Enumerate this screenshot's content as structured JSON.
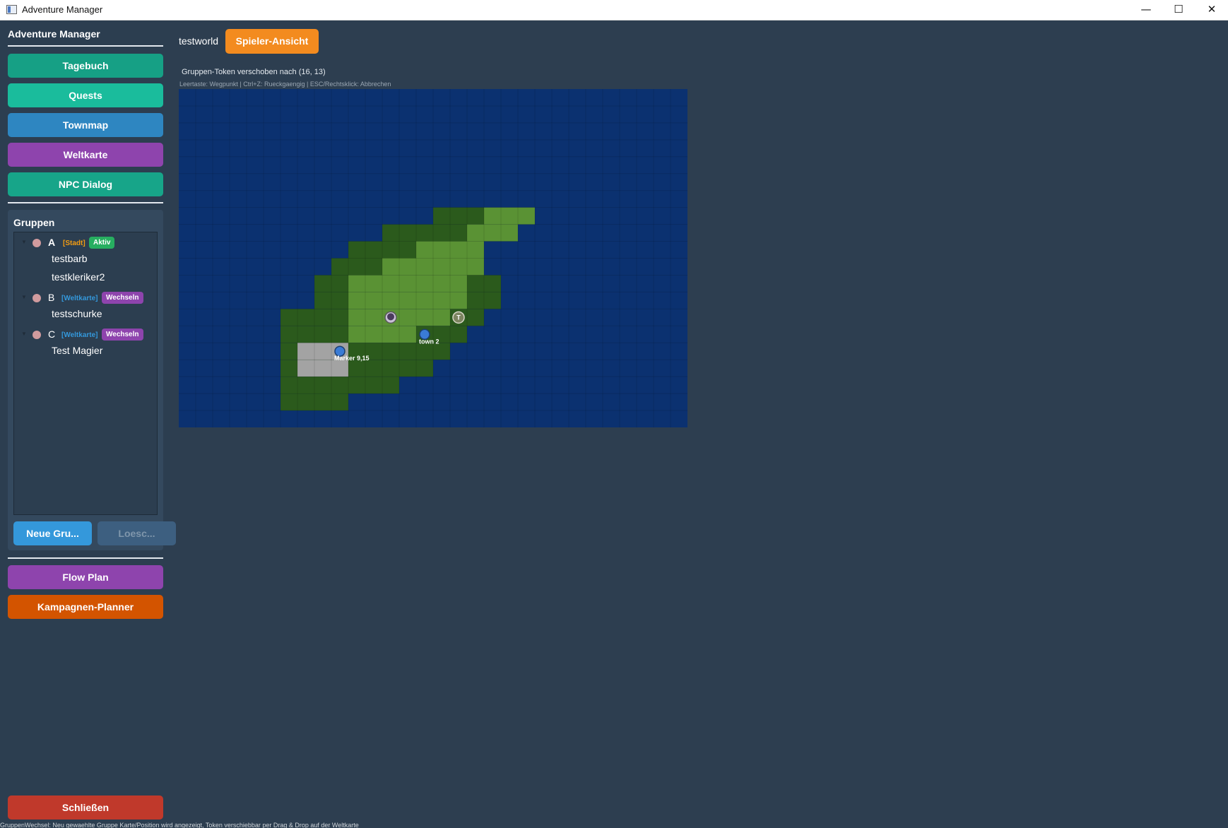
{
  "window": {
    "title": "Adventure Manager",
    "minimize": "—",
    "maximize": "☐",
    "close": "✕"
  },
  "sidebar": {
    "title": "Adventure Manager",
    "nav": [
      {
        "label": "Tagebuch",
        "color": "#16a085"
      },
      {
        "label": "Quests",
        "color": "#1abc9c"
      },
      {
        "label": "Townmap",
        "color": "#2e86c1"
      },
      {
        "label": "Weltkarte",
        "color": "#8e44ad"
      },
      {
        "label": "NPC Dialog",
        "color": "#17a589"
      }
    ],
    "groups": {
      "title": "Gruppen",
      "items": [
        {
          "name": "A",
          "location": "[Stadt]",
          "location_color": "#f39c12",
          "badge": "Aktiv",
          "badge_color": "#27ae60",
          "members": [
            "testbarb",
            "testkleriker2"
          ]
        },
        {
          "name": "B",
          "location": "[Weltkarte]",
          "location_color": "#3498db",
          "badge": "Wechseln",
          "badge_color": "#8e44ad",
          "members": [
            "testschurke"
          ]
        },
        {
          "name": "C",
          "location": "[Weltkarte]",
          "location_color": "#3498db",
          "badge": "Wechseln",
          "badge_color": "#8e44ad",
          "members": [
            "Test Magier"
          ]
        }
      ],
      "new_button": "Neue Gru...",
      "delete_button": "Loesc..."
    },
    "bottom_nav": [
      {
        "label": "Flow Plan",
        "color": "#8e44ad"
      },
      {
        "label": "Kampagnen-Planner",
        "color": "#d35400"
      }
    ],
    "close_button": "Schließen"
  },
  "main": {
    "world_name": "testworld",
    "player_view_button": "Spieler-Ansicht",
    "status": "Gruppen-Token verschoben nach (16, 13)",
    "hint": "Leertaste: Wegpunkt | Ctrl+Z: Rueckgaengig | ESC/Rechtsklick: Abbrechen"
  },
  "map": {
    "cols": 30,
    "rows": 20,
    "colors": {
      "water": "#0b3170",
      "forest": "#2b5a1c",
      "grass": "#5a9234",
      "stone": "#a3a3a3"
    },
    "terrain": [
      {
        "row": 7,
        "forest": [
          [
            15,
            17
          ]
        ],
        "grass": [
          [
            18,
            20
          ]
        ]
      },
      {
        "row": 8,
        "forest": [
          [
            12,
            16
          ]
        ],
        "grass": [
          [
            17,
            19
          ]
        ]
      },
      {
        "row": 9,
        "forest": [
          [
            10,
            13
          ]
        ],
        "grass": [
          [
            14,
            17
          ]
        ]
      },
      {
        "row": 10,
        "forest": [
          [
            9,
            11
          ]
        ],
        "grass": [
          [
            12,
            17
          ]
        ]
      },
      {
        "row": 11,
        "forest": [
          [
            8,
            9
          ],
          [
            17,
            18
          ]
        ],
        "grass": [
          [
            10,
            16
          ]
        ]
      },
      {
        "row": 12,
        "forest": [
          [
            8,
            9
          ],
          [
            17,
            18
          ]
        ],
        "grass": [
          [
            10,
            16
          ]
        ]
      },
      {
        "row": 13,
        "forest": [
          [
            6,
            9
          ],
          [
            16,
            17
          ]
        ],
        "grass": [
          [
            10,
            15
          ]
        ]
      },
      {
        "row": 14,
        "forest": [
          [
            6,
            9
          ],
          [
            14,
            16
          ]
        ],
        "grass": [
          [
            10,
            13
          ]
        ]
      },
      {
        "row": 15,
        "forest": [
          [
            6,
            15
          ]
        ],
        "stone": [
          [
            7,
            9
          ]
        ]
      },
      {
        "row": 16,
        "forest": [
          [
            6,
            14
          ]
        ],
        "stone": [
          [
            7,
            9
          ]
        ]
      },
      {
        "row": 17,
        "forest": [
          [
            6,
            12
          ]
        ]
      },
      {
        "row": 18,
        "forest": [
          [
            6,
            9
          ]
        ]
      }
    ],
    "markers": [
      {
        "label": "town 2",
        "x": 14.5,
        "y": 14.5,
        "kind": "town"
      },
      {
        "label": "Marker 9,15",
        "x": 9.5,
        "y": 15.5,
        "kind": "marker"
      }
    ],
    "tokens": [
      {
        "label": "",
        "x": 12.5,
        "y": 13.5,
        "kind": "avatar"
      },
      {
        "label": "T",
        "x": 16.5,
        "y": 13.5,
        "kind": "letter"
      }
    ]
  },
  "footer_text": "GruppenWechsel: Neu gewaehlte Gruppe Karte/Position wird angezeigt, Token verschiebbar per Drag & Drop auf der Weltkarte"
}
